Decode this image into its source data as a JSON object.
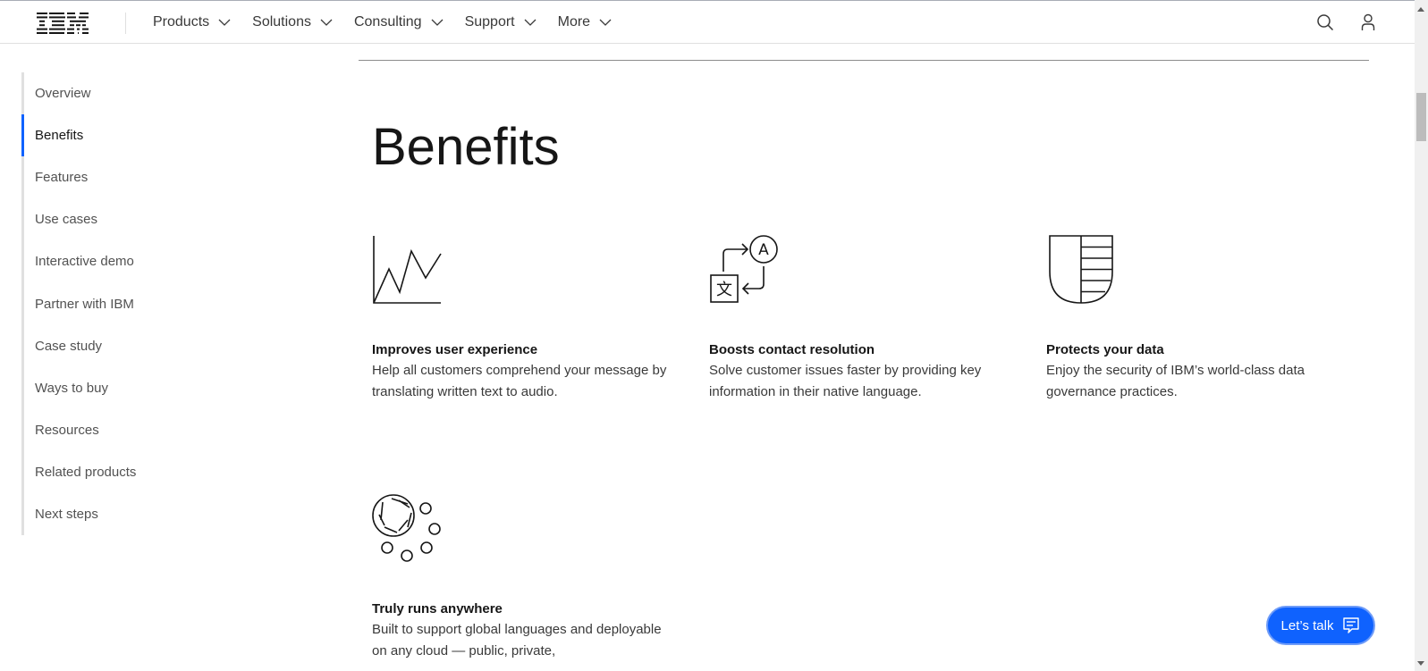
{
  "header": {
    "logo": "IBM",
    "nav": [
      {
        "label": "Products"
      },
      {
        "label": "Solutions"
      },
      {
        "label": "Consulting"
      },
      {
        "label": "Support"
      },
      {
        "label": "More"
      }
    ],
    "icons": [
      "search-icon",
      "user-icon"
    ]
  },
  "sidebar": {
    "active": "Benefits",
    "items": [
      {
        "label": "Overview"
      },
      {
        "label": "Benefits"
      },
      {
        "label": "Features"
      },
      {
        "label": "Use cases"
      },
      {
        "label": "Interactive demo"
      },
      {
        "label": "Partner with IBM"
      },
      {
        "label": "Case study"
      },
      {
        "label": "Ways to buy"
      },
      {
        "label": "Resources"
      },
      {
        "label": "Related products"
      },
      {
        "label": "Next steps"
      }
    ]
  },
  "main": {
    "heading": "Benefits",
    "cards": [
      {
        "icon": "line-chart-icon",
        "title": "Improves user experience",
        "text": "Help all customers comprehend your message by translating written text to audio."
      },
      {
        "icon": "translate-icon",
        "title": "Boosts contact resolution",
        "text": "Solve customer issues faster by providing key information in their native language."
      },
      {
        "icon": "shield-icon",
        "title": "Protects your data",
        "text": "Enjoy the security of IBM’s world-class data governance practices."
      },
      {
        "icon": "cloud-anywhere-icon",
        "title": "Truly runs anywhere",
        "text": "Built to support global languages and deployable on any cloud — public, private,"
      }
    ]
  },
  "chat": {
    "label": "Let’s talk",
    "icon": "chat-icon"
  },
  "colors": {
    "accent": "#0f62fe",
    "text": "#161616",
    "muted": "#525252"
  }
}
